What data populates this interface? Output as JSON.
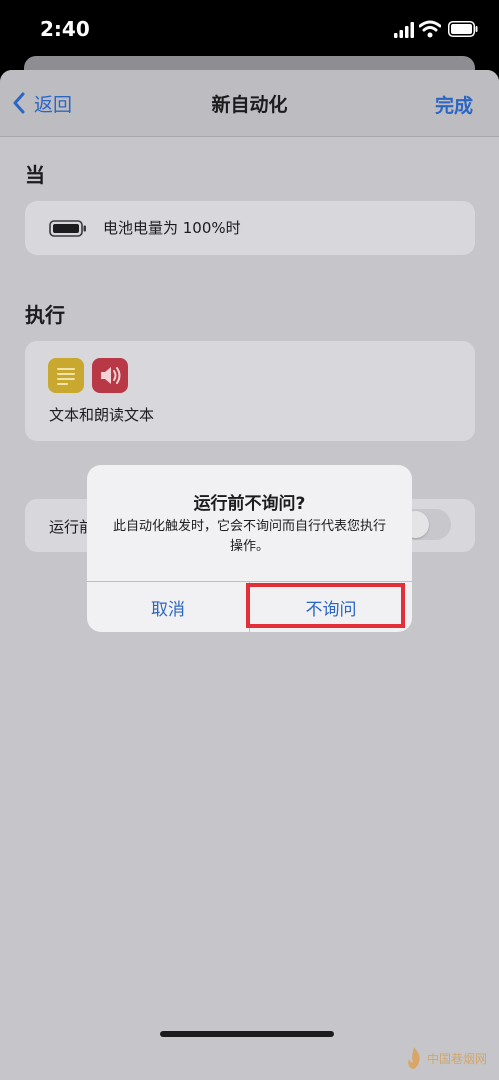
{
  "status_bar": {
    "time": "2:40"
  },
  "nav": {
    "back_label": "返回",
    "title": "新自动化",
    "done_label": "完成"
  },
  "trigger": {
    "section_title": "当",
    "battery_text": "电池电量为 100%时"
  },
  "action": {
    "section_title": "执行",
    "label": "文本和朗读文本"
  },
  "setting": {
    "label": "运行前询问",
    "enabled": false
  },
  "alert": {
    "title": "运行前不询问?",
    "message": "此自动化触发时，它会不询问而自行代表您执行操作。",
    "cancel_label": "取消",
    "confirm_label": "不询问"
  },
  "watermark": {
    "text": "中国巷烟网"
  },
  "colors": {
    "accent": "#2b66c4",
    "highlight": "#e22f3a"
  }
}
